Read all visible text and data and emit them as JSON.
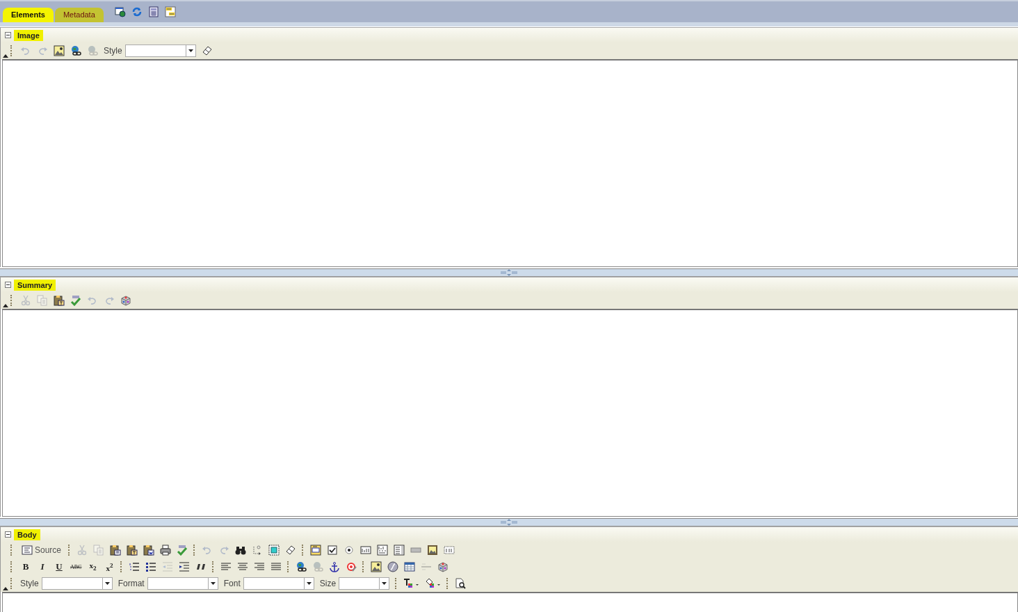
{
  "tabs": [
    {
      "label": "Elements",
      "selected": true
    },
    {
      "label": "Metadata",
      "selected": false
    }
  ],
  "top_tools": [
    {
      "kind": "web"
    },
    {
      "kind": "refresh"
    },
    {
      "kind": "calc"
    },
    {
      "kind": "note"
    }
  ],
  "sections": [
    {
      "title": "Image",
      "expanded": true,
      "toolbars": [
        [
          {
            "kind": "undo",
            "disabled": true
          },
          {
            "kind": "redo",
            "disabled": true
          },
          {
            "kind": "image",
            "disabled": false
          },
          {
            "kind": "link",
            "disabled": false
          },
          {
            "kind": "unlink",
            "disabled": true
          },
          {
            "kind": "label",
            "text": "Style"
          },
          {
            "kind": "combo"
          },
          {
            "kind": "eraser",
            "disabled": false
          }
        ]
      ]
    },
    {
      "title": "Summary",
      "expanded": true,
      "toolbars": [
        [
          {
            "kind": "cut",
            "disabled": true
          },
          {
            "kind": "copy",
            "disabled": true
          },
          {
            "kind": "pastetext",
            "disabled": false
          },
          {
            "kind": "spell",
            "disabled": false
          },
          {
            "kind": "undo",
            "disabled": true
          },
          {
            "kind": "redo",
            "disabled": true
          },
          {
            "kind": "cube",
            "disabled": false
          }
        ]
      ]
    },
    {
      "title": "Body",
      "expanded": true,
      "toolbars": [
        [
          {
            "kind": "source",
            "text": "Source",
            "disabled": false
          },
          {
            "kind": "sep"
          },
          {
            "kind": "cut",
            "disabled": true
          },
          {
            "kind": "copy",
            "disabled": true
          },
          {
            "kind": "paste",
            "disabled": false
          },
          {
            "kind": "pastetext",
            "disabled": false
          },
          {
            "kind": "pasteword",
            "disabled": false
          },
          {
            "kind": "print",
            "disabled": false
          },
          {
            "kind": "spell",
            "disabled": false
          },
          {
            "kind": "sep"
          },
          {
            "kind": "undo",
            "disabled": true
          },
          {
            "kind": "redo",
            "disabled": true
          },
          {
            "kind": "find",
            "disabled": false
          },
          {
            "kind": "replace",
            "disabled": false
          },
          {
            "kind": "selectall",
            "disabled": false
          },
          {
            "kind": "eraser",
            "disabled": false
          },
          {
            "kind": "sep"
          },
          {
            "kind": "form",
            "disabled": false
          },
          {
            "kind": "checkbox",
            "disabled": false
          },
          {
            "kind": "radio",
            "disabled": false
          },
          {
            "kind": "textfield",
            "disabled": false
          },
          {
            "kind": "textarea",
            "disabled": false
          },
          {
            "kind": "select",
            "disabled": false
          },
          {
            "kind": "button",
            "disabled": false
          },
          {
            "kind": "imagebutton",
            "disabled": false
          },
          {
            "kind": "hidden",
            "disabled": false
          }
        ],
        [
          {
            "kind": "glyph",
            "text": "B",
            "disabled": false
          },
          {
            "kind": "glyph",
            "text": "I",
            "disabled": false
          },
          {
            "kind": "glyph",
            "text": "U",
            "disabled": false
          },
          {
            "kind": "glyph",
            "text": "ABC",
            "disabled": false
          },
          {
            "kind": "glyph",
            "text": "x$_{2}$",
            "disabled": false
          },
          {
            "kind": "glyph",
            "text": "x$^{2}$",
            "disabled": false
          },
          {
            "kind": "sep"
          },
          {
            "kind": "ol",
            "disabled": false
          },
          {
            "kind": "ul",
            "disabled": false
          },
          {
            "kind": "outdent",
            "disabled": true
          },
          {
            "kind": "indent",
            "disabled": false
          },
          {
            "kind": "quote",
            "disabled": false
          },
          {
            "kind": "sep"
          },
          {
            "kind": "alignleft",
            "disabled": false
          },
          {
            "kind": "aligncenter",
            "disabled": false
          },
          {
            "kind": "alignright",
            "disabled": false
          },
          {
            "kind": "justify",
            "disabled": false
          },
          {
            "kind": "sep"
          },
          {
            "kind": "link",
            "disabled": false
          },
          {
            "kind": "unlink",
            "disabled": true
          },
          {
            "kind": "anchor",
            "disabled": false
          },
          {
            "kind": "target",
            "disabled": false
          },
          {
            "kind": "sep"
          },
          {
            "kind": "image",
            "disabled": false
          },
          {
            "kind": "flash",
            "disabled": false
          },
          {
            "kind": "table",
            "disabled": false
          },
          {
            "kind": "rule",
            "disabled": true
          },
          {
            "kind": "cube",
            "disabled": false
          }
        ],
        [
          {
            "kind": "label",
            "text": "Style"
          },
          {
            "kind": "combo"
          },
          {
            "kind": "label",
            "text": "Format"
          },
          {
            "kind": "combo"
          },
          {
            "kind": "label",
            "text": "Font"
          },
          {
            "kind": "combo"
          },
          {
            "kind": "label",
            "text": "Size"
          },
          {
            "kind": "combo"
          },
          {
            "kind": "sep"
          },
          {
            "kind": "textcolor",
            "disabled": false
          },
          {
            "kind": "bgcolor",
            "disabled": false
          },
          {
            "kind": "sep"
          },
          {
            "kind": "preview",
            "disabled": false
          }
        ]
      ]
    }
  ]
}
